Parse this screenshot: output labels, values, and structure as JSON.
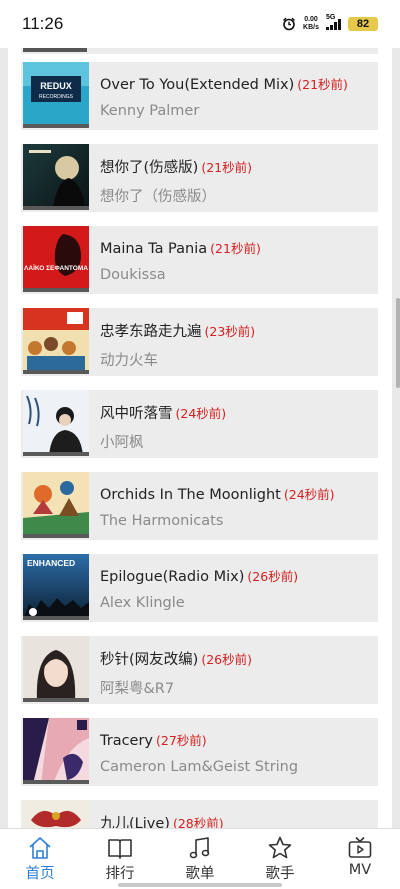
{
  "status": {
    "time": "11:26",
    "net_speed_value": "0.00",
    "net_speed_unit": "KB/s",
    "signal_label": "5G",
    "battery": "82"
  },
  "songs": [
    {
      "title": "Over To You(Extended Mix)",
      "time_ago": "(21秒前)",
      "artist": "Kenny Palmer",
      "cover_text": "REDUX",
      "cover_subtext": "RECORDINGS"
    },
    {
      "title": "想你了(伤感版)",
      "time_ago": "(21秒前)",
      "artist": "想你了（伤感版）"
    },
    {
      "title": "Maina Ta Pania",
      "time_ago": "(21秒前)",
      "artist": "Doukissa",
      "cover_text": "ΛΑΪΚΟ ΣΕΦΑΝΤΟΜΑ"
    },
    {
      "title": "忠孝东路走九遍",
      "time_ago": "(23秒前)",
      "artist": "动力火车"
    },
    {
      "title": "风中听落雪",
      "time_ago": "(24秒前)",
      "artist": "小阿枫"
    },
    {
      "title": "Orchids In The Moonlight",
      "time_ago": "(24秒前)",
      "artist": "The Harmonicats"
    },
    {
      "title": "Epilogue(Radio Mix)",
      "time_ago": "(26秒前)",
      "artist": "Alex Klingle",
      "cover_text": "ENHANCED"
    },
    {
      "title": "秒针(网友改编)",
      "time_ago": "(26秒前)",
      "artist": "阿梨粤&R7"
    },
    {
      "title": "Tracery",
      "time_ago": "(27秒前)",
      "artist": "Cameron Lam&Geist String"
    },
    {
      "title": "九儿(Live)",
      "time_ago": "(28秒前)",
      "artist": ""
    }
  ],
  "tabs": [
    {
      "label": "首页",
      "icon": "home-icon",
      "active": true
    },
    {
      "label": "排行",
      "icon": "book-icon",
      "active": false
    },
    {
      "label": "歌单",
      "icon": "music-note-icon",
      "active": false
    },
    {
      "label": "歌手",
      "icon": "star-icon",
      "active": false
    },
    {
      "label": "MV",
      "icon": "tv-icon",
      "active": false
    }
  ],
  "colors": {
    "accent": "#2f7fd8",
    "time_ago": "#d42020",
    "card_bg": "#ececec",
    "page_bg": "#e9e9e9"
  }
}
